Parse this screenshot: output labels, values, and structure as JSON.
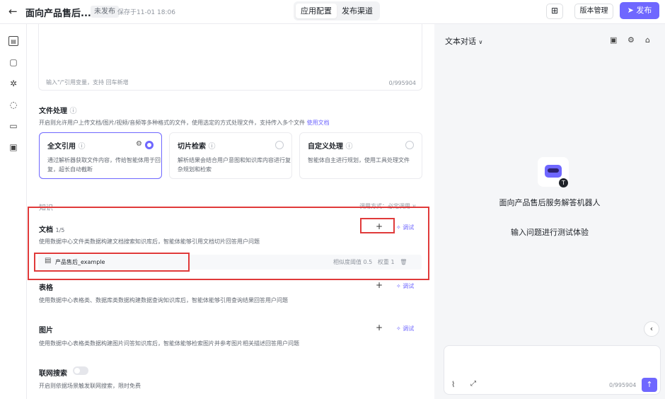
{
  "header": {
    "back_icon": "back-arrow-icon",
    "title": "面向产品售后...",
    "status_badge": "未发布",
    "saved_text": "保存于11-01 18:06",
    "tabs": [
      "应用配置",
      "发布渠道"
    ],
    "active_tab": "应用配置",
    "grid_icon": "apps-grid-icon",
    "version_button": "版本管理",
    "publish_button": "发布",
    "publish_icon": "send-icon",
    "accent_color": "#6f67ff"
  },
  "left_nav": {
    "icons": [
      "config-icon",
      "document-icon",
      "sparkle-icon",
      "bulb-icon",
      "chat-icon",
      "briefcase-icon"
    ]
  },
  "prompt": {
    "hint": "输入\"/\"引用变量，支持 回车新增",
    "count": "0/995904"
  },
  "file_processing": {
    "title": "文件处理",
    "info_icon": "info-icon",
    "desc": "开启则允许用户上传文档/图片/视频/音频等多种格式的文件，使用选定的方式处理文件，支持传入多个文件",
    "link": "使用文档",
    "cards": [
      {
        "title": "全文引用",
        "desc": "通过解析器获取文件内容，传给智能体用于回复，超长自动截断",
        "selected": true
      },
      {
        "title": "切片检索",
        "desc": "解析结果会结合用户意图和知识库内容进行复杂规划和检索",
        "selected": false
      },
      {
        "title": "自定义处理",
        "desc": "智能体自主进行规划，使用工具处理文件",
        "selected": false
      }
    ]
  },
  "knowledge": {
    "title": "知识",
    "call_mode": "调用方式：必定调用 ∨",
    "docs": {
      "title": "文档",
      "count": "1/5",
      "desc": "使用数据中心文件类数据构建文档搜索知识库后，智能体能够引用文档切片回答用户问题",
      "add": "+",
      "debug": "调试",
      "item_name": "产品售后_example",
      "threshold_label": "相似度阈值",
      "threshold_value": "0.5",
      "weight_label": "权重",
      "weight_value": "1"
    },
    "tables": {
      "title": "表格",
      "desc": "使用数据中心表格类、数据库类数据构建数据查询知识库后，智能体能够引用查询结果回答用户问题",
      "add": "+",
      "debug": "调试"
    },
    "images": {
      "title": "图片",
      "desc": "使用数据中心表格类数据构建图片问答知识库后，智能体能够检索图片并参考图片相关描述回答用户问题",
      "add": "+",
      "debug": "调试"
    }
  },
  "web_search": {
    "title": "联网搜索",
    "enabled": false,
    "desc": "开启则依据场景触发联网搜索，限时免费"
  },
  "preview": {
    "mode": "文本对话",
    "header_icons": [
      "briefcase-icon",
      "settings-icon",
      "clear-icon"
    ],
    "bot_name": "面向产品售后服务解答机器人",
    "hint": "输入问题进行测试体验",
    "count": "0/995904",
    "send_icon": "arrow-up-icon"
  }
}
